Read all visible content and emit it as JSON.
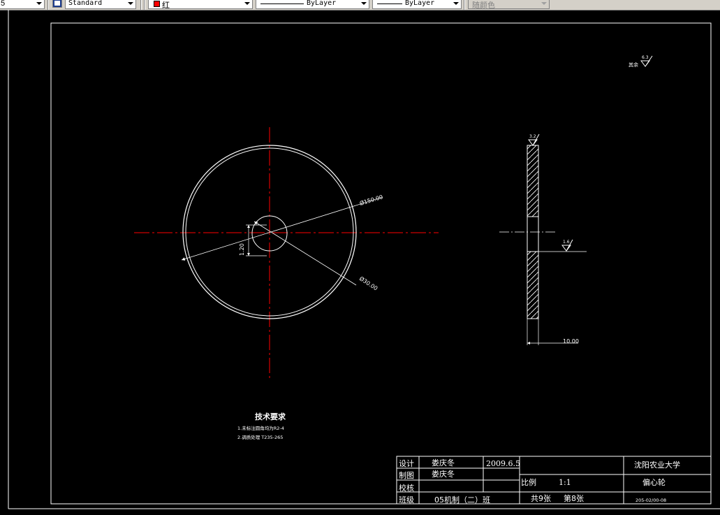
{
  "toolbar": {
    "left_value": "5",
    "textstyle": "Standard",
    "color": {
      "label": "红",
      "swatch": "#ff0000"
    },
    "linetype": "ByLayer",
    "lineweight": "ByLayer",
    "plotstyle": "随颜色"
  },
  "drawing": {
    "roughness_corner_label": "其余",
    "roughness_corner_value": "6.3",
    "roughness_top_value": "3.2",
    "roughness_side_value": "1.6",
    "dim_diameter_outer": "Ø150.00",
    "dim_diameter_hole": "Ø30.00",
    "dim_offset": "1.20",
    "dim_thickness": "10.00",
    "tech_title": "技术要求",
    "tech_note_1": "1.未标注圆角均为R2-4",
    "tech_note_2": "2.调质处理 T235-265"
  },
  "title_block": {
    "design_label": "设计",
    "design_name": "娄庆冬",
    "design_date": "2009.6.5",
    "draft_label": "制图",
    "draft_name": "娄庆冬",
    "check_label": "校核",
    "class_label": "班级",
    "class_value": "05机制（二）班",
    "school": "沈阳农业大学",
    "scale_label": "比例",
    "scale_value": "1:1",
    "part_name": "偏心轮",
    "total_sheets": "共9张",
    "sheet_no": "第8张",
    "drawing_no": "205-02/00-08"
  },
  "colors": {
    "background": "#000000",
    "lines": "#ffffff",
    "centerline": "#ff0000",
    "toolbar": "#d4d0c8"
  }
}
